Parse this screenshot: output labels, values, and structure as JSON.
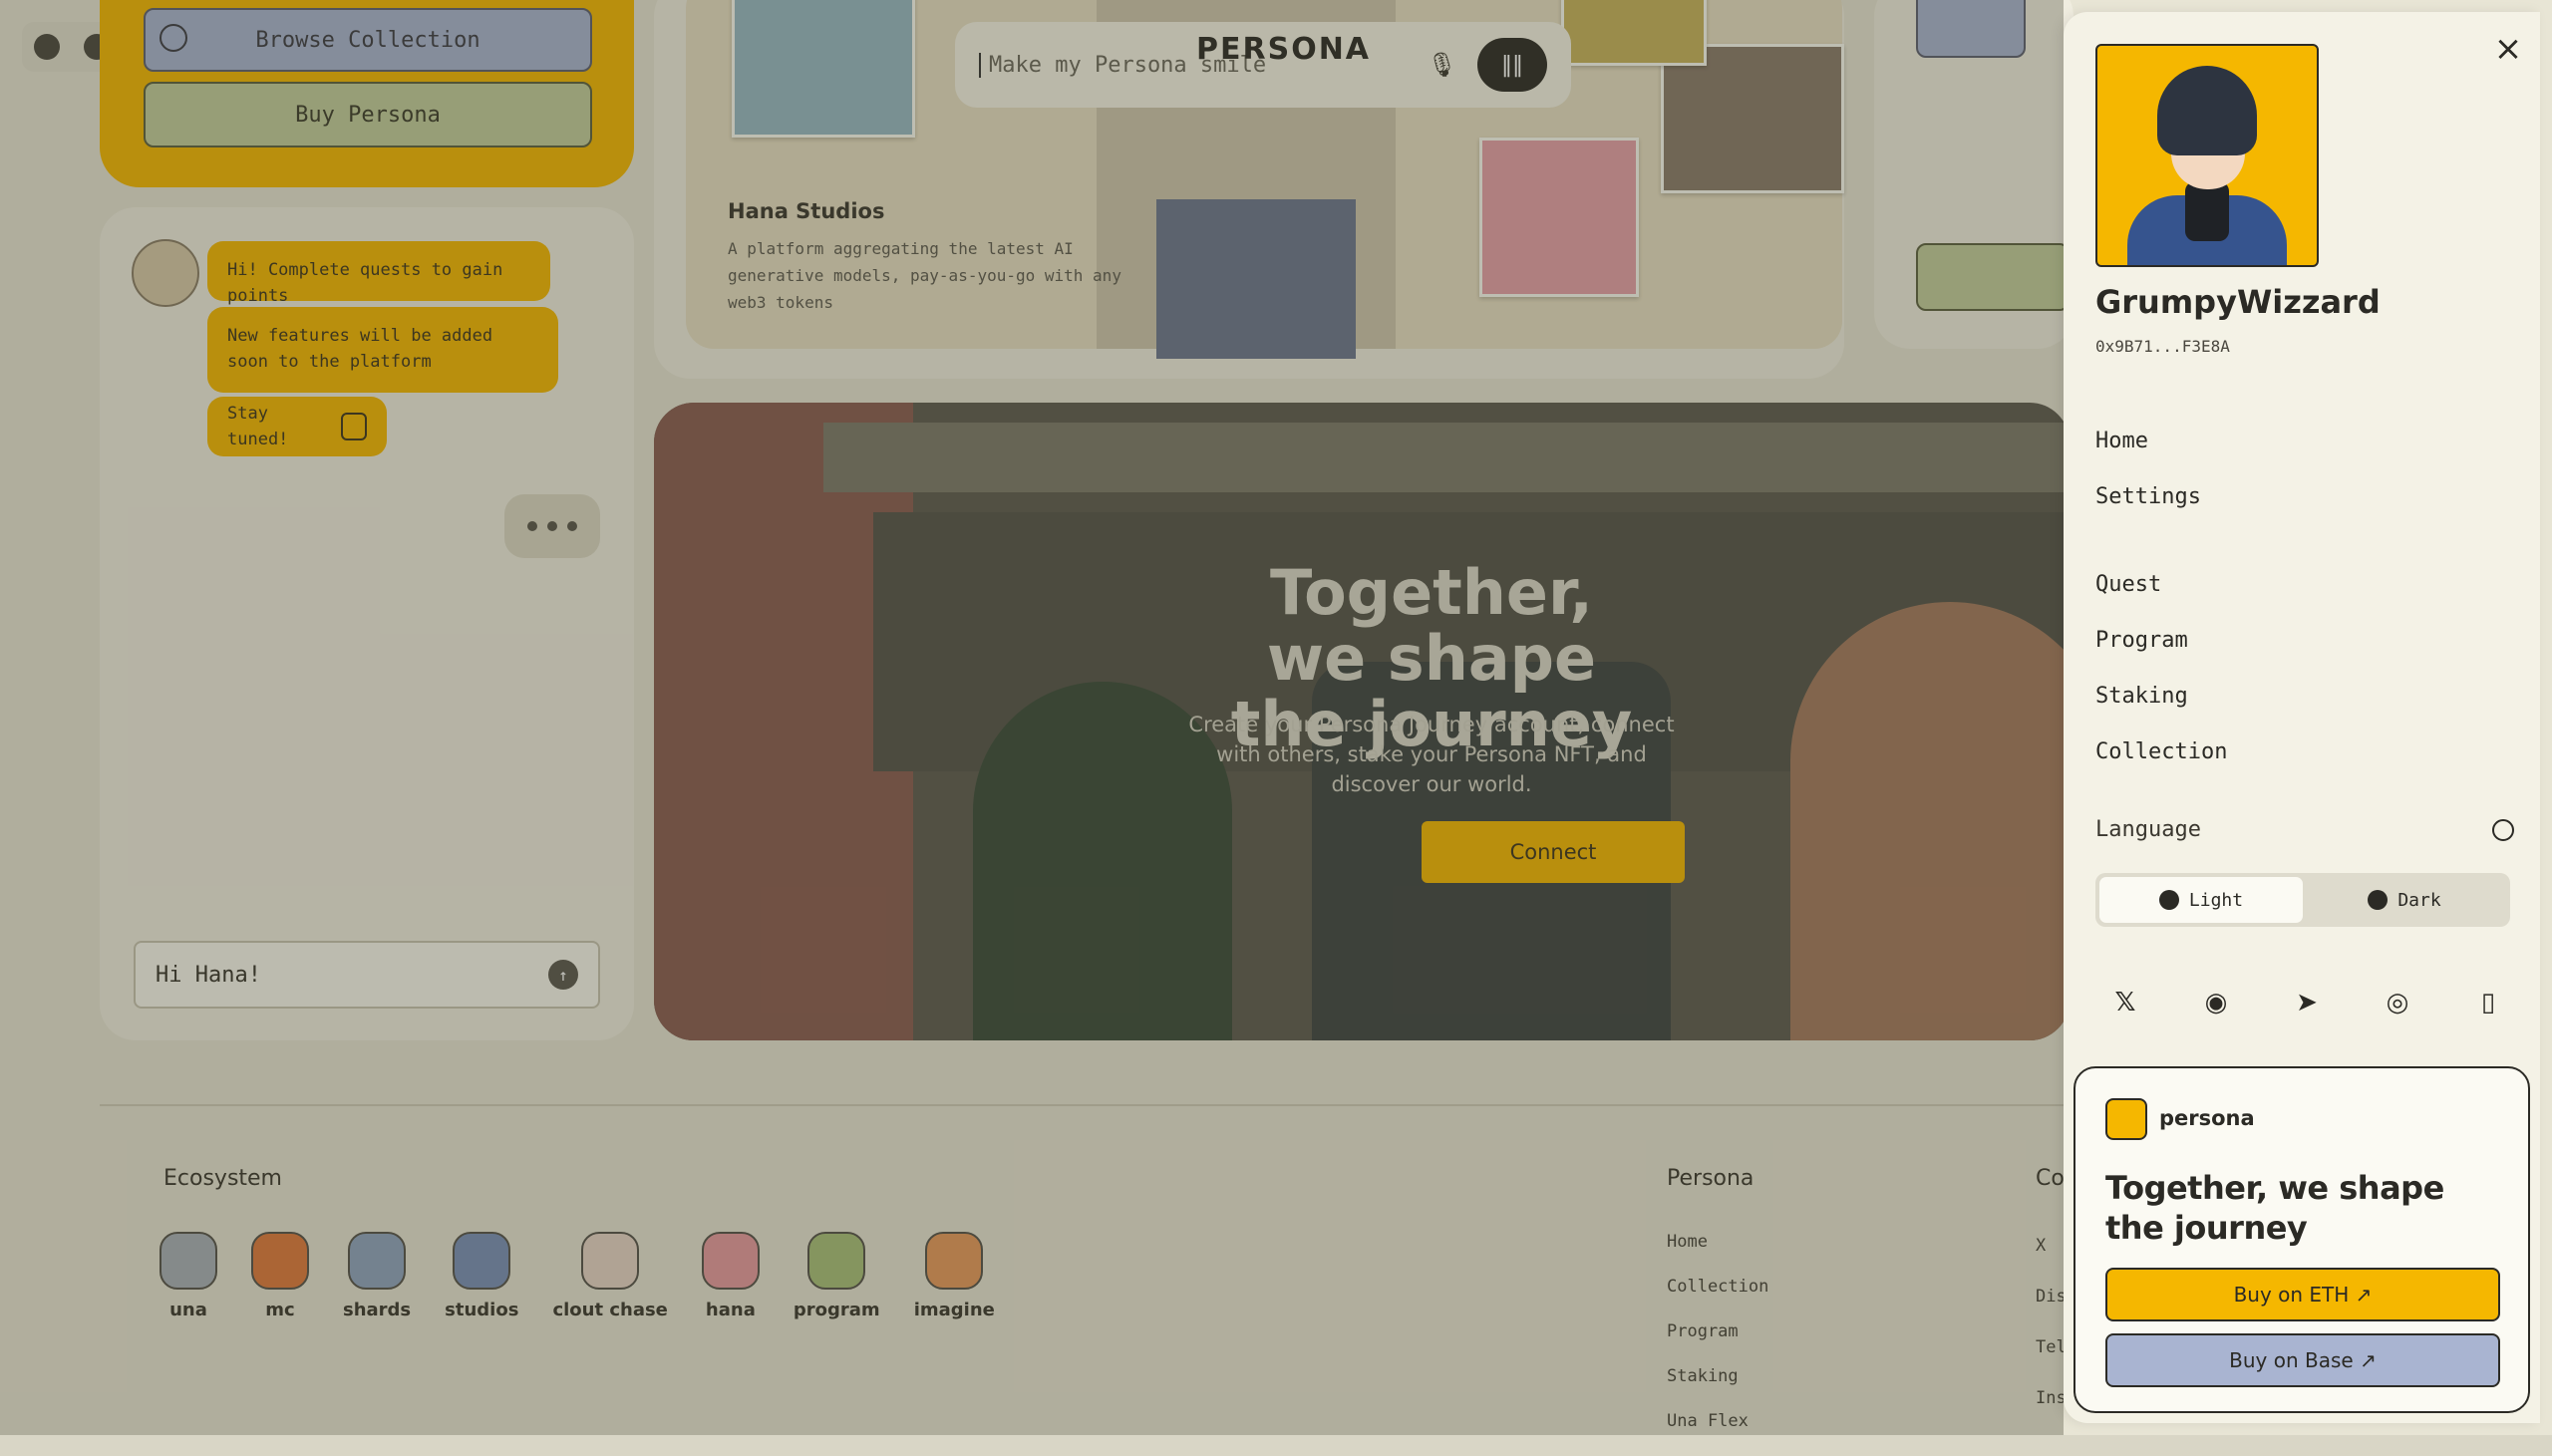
{
  "page": {
    "browse_label": "Browse Collection",
    "buy_label": "Buy Persona"
  },
  "chat": {
    "messages": [
      "Hi! Complete quests to gain points",
      "New features will be added soon to the platform",
      "Stay tuned!"
    ],
    "input_value": "Hi Hana!"
  },
  "studio": {
    "search_placeholder": "Make my Persona smile",
    "logo_text": "PERSONA",
    "title": "Hana Studios",
    "description": "A platform aggregating the latest AI generative models, pay-as-you-go with any web3 tokens"
  },
  "hero": {
    "title": "Together, we shape the journey",
    "subtitle": "Create your Persona Journey account, connect with others, stake your Persona NFT, and discover our world.",
    "cta": "Connect"
  },
  "footer": {
    "ecosystem_title": "Ecosystem",
    "ecosystem": [
      {
        "label": "una",
        "color": "#a8b0b8"
      },
      {
        "label": "mc",
        "color": "#e07a3c"
      },
      {
        "label": "shards",
        "color": "#8fa4c0"
      },
      {
        "label": "studios",
        "color": "#7a90b8"
      },
      {
        "label": "clout chase",
        "color": "#e8d4c8"
      },
      {
        "label": "hana",
        "color": "#e89aa0"
      },
      {
        "label": "program",
        "color": "#a8c07a"
      },
      {
        "label": "imagine",
        "color": "#e89a5c"
      }
    ],
    "persona_title": "Persona",
    "persona_links": [
      "Home",
      "Collection",
      "Program",
      "Staking",
      "Una Flex"
    ],
    "col2_title": "Co",
    "col2_links": [
      "X",
      "Dis",
      "Tel",
      "Ins"
    ]
  },
  "drawer": {
    "user_name": "GrumpyWizzard",
    "wallet": "0x9B71...F3E8A",
    "menu_primary": [
      "Home",
      "Settings"
    ],
    "menu_secondary": [
      "Quest",
      "Program",
      "Staking",
      "Collection"
    ],
    "language_label": "Language",
    "theme_light": "Light",
    "theme_dark": "Dark",
    "social_icons": [
      "x-icon",
      "discord-icon",
      "telegram-icon",
      "instagram-icon",
      "document-icon"
    ],
    "buy_card": {
      "brand": "persona",
      "title": "Together, we shape the journey",
      "eth_label": "Buy on ETH ↗",
      "base_label": "Buy on Base ↗"
    }
  },
  "colors": {
    "accent": "#f5b700",
    "accent_blue": "#a9b4d1",
    "accent_green": "#c3cd9c"
  }
}
